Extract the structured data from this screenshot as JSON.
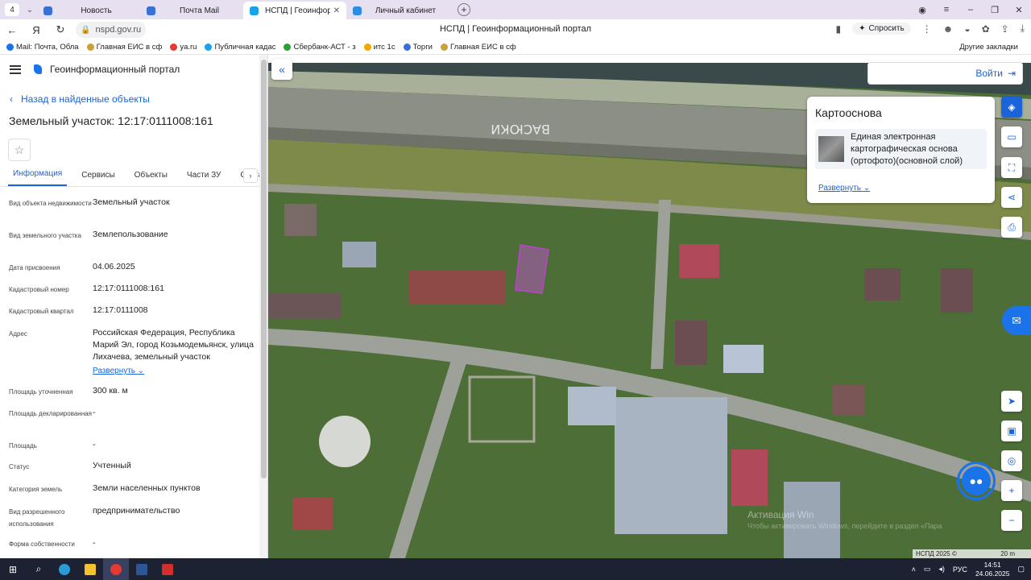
{
  "browser": {
    "tab_count": "4",
    "tabs": [
      {
        "label": "Новость",
        "color": "#3b6fd8"
      },
      {
        "label": "Почта Mail",
        "color": "#3b6fd8"
      },
      {
        "label": "НСПД | Геоинформаци",
        "color": "#1aa3e8"
      },
      {
        "label": "Личный кабинет",
        "color": "#2d8de0"
      }
    ],
    "url": "nspd.gov.ru",
    "page_title": "НСПД | Геоинформационный портал",
    "ask_label": "Спросить",
    "bookmarks": [
      {
        "label": "Mail: Почта, Обла",
        "color": "#1a73e8"
      },
      {
        "label": "Главная ЕИС в сф",
        "color": "#c9a13a"
      },
      {
        "label": "ya.ru",
        "color": "#e53935"
      },
      {
        "label": "Публичная кадас",
        "color": "#1aa3e8"
      },
      {
        "label": "Сбербанк-АСТ - з",
        "color": "#2e9e3e"
      },
      {
        "label": "итс 1с",
        "color": "#f2a600"
      },
      {
        "label": "Торги",
        "color": "#3b6fd8"
      },
      {
        "label": "Главная ЕИС в сф",
        "color": "#c9a13a"
      }
    ],
    "other_bookmarks": "Другие закладки"
  },
  "panel": {
    "title": "Геоинформационный портал",
    "back_label": "Назад в найденные объекты",
    "object_title": "Земельный участок: 12:17:0111008:161",
    "tabs": [
      "Информация",
      "Сервисы",
      "Объекты",
      "Части ЗУ",
      "Соста"
    ],
    "rows": [
      {
        "key": "Вид объекта недвижимости",
        "value": "Земельный участок"
      },
      {
        "key": "Вид земельного участка",
        "value": "Землепользование"
      },
      {
        "key": "Дата присвоения",
        "value": "04.06.2025"
      },
      {
        "key": "Кадастровый номер",
        "value": "12:17:0111008:161"
      },
      {
        "key": "Кадастровый квартал",
        "value": "12:17:0111008"
      },
      {
        "key": "Адрес",
        "value": "Российская Федерация, Республика Марий Эл, город Козьмодемьянск, улица Лихачева, земельный участок",
        "more": "Развернуть"
      },
      {
        "key": "Площадь уточненная",
        "value": "300 кв. м"
      },
      {
        "key": "Площадь декларированная",
        "value": "-"
      },
      {
        "key": "Площадь",
        "value": "-"
      },
      {
        "key": "Статус",
        "value": "Учтенный"
      },
      {
        "key": "Категория земель",
        "value": "Земли населенных пунктов"
      },
      {
        "key": "Вид разрешенного использования",
        "value": "предпринимательство"
      },
      {
        "key": "Форма собственности",
        "value": "-"
      }
    ]
  },
  "map": {
    "login_label": "Войти",
    "basemap_title": "Картооснова",
    "basemap_layer": "Единая электронная картографическая основа (ортофото)(основной слой)",
    "basemap_expand": "Развернуть",
    "watermark_line1": "Активация Win",
    "watermark_line2": "Чтобы активировать Windows, перейдите в раздел «Пара",
    "attribution": "НСПД 2025 ©",
    "scale": "20 m",
    "road_text": "ВАСЮКИ"
  },
  "taskbar": {
    "lang": "РУС",
    "time": "14:51",
    "date": "24.06.2025"
  }
}
